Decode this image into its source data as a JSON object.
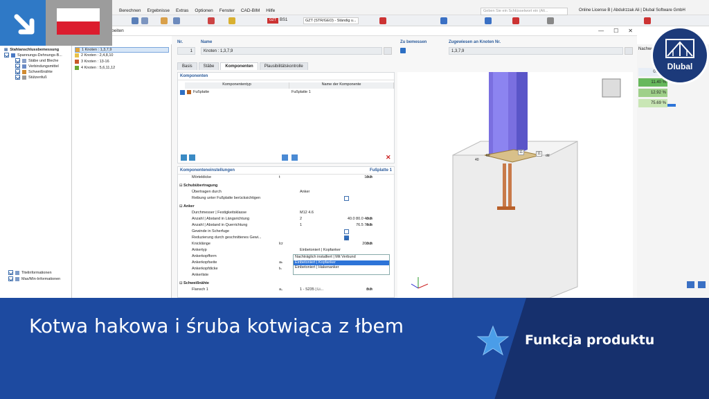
{
  "menu": [
    "Berechnen",
    "Ergebnisse",
    "Extras",
    "Optionen",
    "Fenster",
    "CAD-BIM",
    "Hilfe"
  ],
  "search_placeholder": "Geben Sie ein Schlüsselwort ein (Alt...",
  "license": "Online License B | Abdulrzzak Ali | Dlubal Software GmbH",
  "toolbar": {
    "design_situation": "BS1",
    "combo": "GZT (STR/GEO) - Ständig u..."
  },
  "dialog": {
    "title": "bearbeiten",
    "no_label": "Nr.",
    "no_value": "1",
    "name_label": "Name",
    "name_value": "Knoten : 1,3,7,9",
    "design_label": "Zu bemessen",
    "assigned_label": "Zugewiesen an Knoten Nr.",
    "assigned_value": "1,3,7,9"
  },
  "tabs": [
    "Basis",
    "Stäbe",
    "Komponenten",
    "Plausibilitätskontrolle"
  ],
  "components": {
    "title": "Komponenten",
    "col_type": "Komponententyp",
    "col_name": "Name der Komponente",
    "row_type": "Fußplatte",
    "row_name": "Fußplatte 1"
  },
  "settings": {
    "title": "Komponenteneinstellungen",
    "right": "Fußplatte 1",
    "rows": [
      {
        "n": "Mörteldicke",
        "s": "t",
        "val": "10.0",
        "u": "mm"
      },
      {
        "grp": "Schubübertragung"
      },
      {
        "n": "Übertragen durch",
        "v": "Anker"
      },
      {
        "n": "Reibung unter Fußplatte berücksichtigen"
      },
      {
        "grp": "Anker"
      },
      {
        "n": "Durchmesser | Festigkeitsklasse",
        "v": "M12    4.6"
      },
      {
        "n": "Anzahl | Abstand in Längsrichtung",
        "v": "2",
        "val": "40.0 80.0 40.0",
        "u": "mm"
      },
      {
        "n": "Anzahl | Abstand in Querrichtung",
        "v": "1",
        "val": "76.5 76.5",
        "u": "mm"
      },
      {
        "n": "Gewinde in Scherfuge"
      },
      {
        "n": "Reduzierung durch geschnittenes Gewi..."
      },
      {
        "n": "Knicklänge",
        "s": "lcr",
        "val": "200.0",
        "u": "mm"
      },
      {
        "n": "Ankertyp",
        "v": "Einbetoniert | Kopfanker"
      },
      {
        "n": "Ankerkopfform"
      },
      {
        "n": "Ankerkopfseite",
        "s": "aₕ"
      },
      {
        "n": "Ankerkopfdicke",
        "s": "tₕ"
      },
      {
        "n": "Ankerliste"
      },
      {
        "grp": "Schweißnähte"
      },
      {
        "n": "Flansch 1",
        "s": "aₛ",
        "v": "1 - S235 | Li...",
        "val": "3.0",
        "u": "mm"
      }
    ],
    "dropdown": [
      "Einbetoniert | Kopfanker",
      "Nachträglich installiert | Mit Verbund",
      "Einbetoniert | Kopfanker",
      "Einbetoniert | Hakenanker"
    ]
  },
  "navigator": {
    "root": "Stahlanschlussbemessung",
    "items": [
      "Spannungs-Dehnungs-B...",
      "Stäbe und Bleche",
      "Verbindungsmittel",
      "Schweißnähte",
      "Stützenfuß"
    ],
    "bottom": [
      "Titelinformationen",
      "Max/Min-Informationen"
    ]
  },
  "nodes": [
    {
      "label": "1  Knoten : 1,3,7,9",
      "color": "#e0a23a"
    },
    {
      "label": "2  Knoten : 2,4,8,10",
      "color": "#e8c24a"
    },
    {
      "label": "3  Knoten : 13-16",
      "color": "#c85a2a"
    },
    {
      "label": "4  Knoten : 5,6,11,12",
      "color": "#6aa832"
    }
  ],
  "results": {
    "header": "Nachwei",
    "values": [
      "0.00 %",
      "11.40 %",
      "12.92 %",
      "75.69 %"
    ]
  },
  "view": {
    "labels": [
      "11",
      "11",
      "40",
      "60",
      "dd"
    ]
  },
  "banner": {
    "headline": "Kotwa hakowa i śruba kotwiąca z łbem",
    "feature": "Funkcja produktu"
  },
  "logo": "Dlubal",
  "colors": {
    "banner_dark": "#16306d",
    "banner_mid": "#1d4aa0",
    "accent": "#2f79c6",
    "star": "#4a9de8"
  }
}
